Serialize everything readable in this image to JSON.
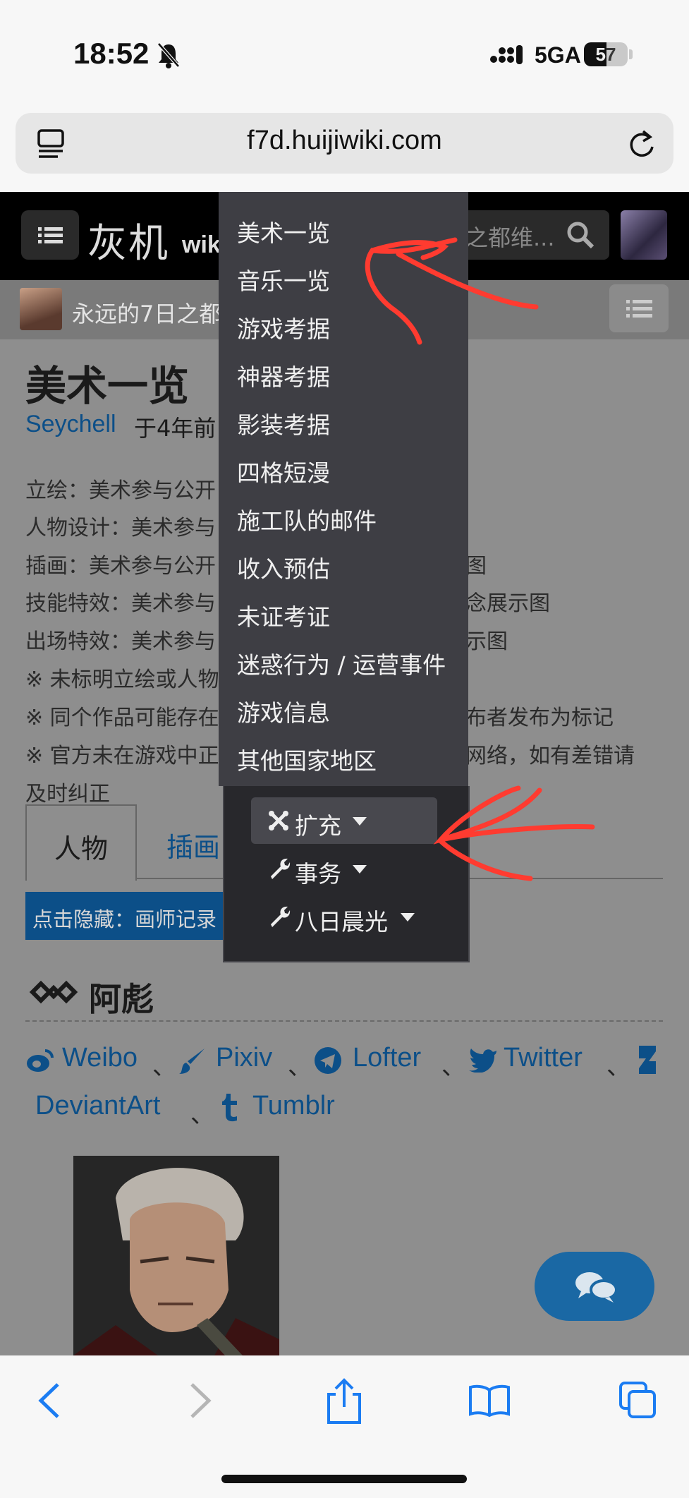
{
  "status": {
    "time": "18:52",
    "network": "5GA",
    "battery": "57"
  },
  "browser": {
    "url": "f7d.huijiwiki.com"
  },
  "site": {
    "logo": "灰机",
    "logo_suffix": "wiki",
    "search_placeholder": "之都维...",
    "wiki_title": "永远的7日之都"
  },
  "page": {
    "title": "美术一览",
    "author": "Seychell",
    "author_suffix": "于4年前",
    "lines": [
      {
        "left": "立绘：美术参与公开",
        "right": ""
      },
      {
        "left": "人物设计：美术参与",
        "right": ""
      },
      {
        "left": "插画：美术参与公开",
        "right": "图"
      },
      {
        "left": "技能特效：美术参与",
        "right": "念展示图"
      },
      {
        "left": "出场特效：美术参与",
        "right": "示图"
      },
      {
        "left": "※ 未标明立绘或人物",
        "right": ""
      },
      {
        "left": "※ 同个作品可能存在",
        "right": "布者发布为标记"
      },
      {
        "left": "※ 官方未在游戏中正",
        "right": "网络，如有差错请"
      },
      {
        "left": "及时纠正",
        "right": ""
      }
    ],
    "tabs": [
      "人物",
      "插画"
    ],
    "hide_bar": "点击隐藏：画师记录",
    "section_title": "阿彪",
    "links": [
      "Weibo",
      "Pixiv",
      "Lofter",
      "Twitter",
      "DeviantArt",
      "Tumblr"
    ],
    "link_separator": "、"
  },
  "dropdown": {
    "items": [
      "美术一览",
      "音乐一览",
      "游戏考据",
      "神器考据",
      "影装考据",
      "四格短漫",
      "施工队的邮件",
      "收入预估",
      "未证考证",
      "迷惑行为 / 运营事件",
      "游戏信息",
      "其他国家地区"
    ]
  },
  "submenu": {
    "items": [
      {
        "label": "扩充",
        "icon": "joomla-icon"
      },
      {
        "label": "事务",
        "icon": "wrench-icon"
      },
      {
        "label": "八日晨光",
        "icon": "wrench-icon"
      }
    ]
  },
  "colors": {
    "annotation": "#ff3b30",
    "link": "#0c4f88",
    "dropdown_bg": "#3e3e44"
  }
}
